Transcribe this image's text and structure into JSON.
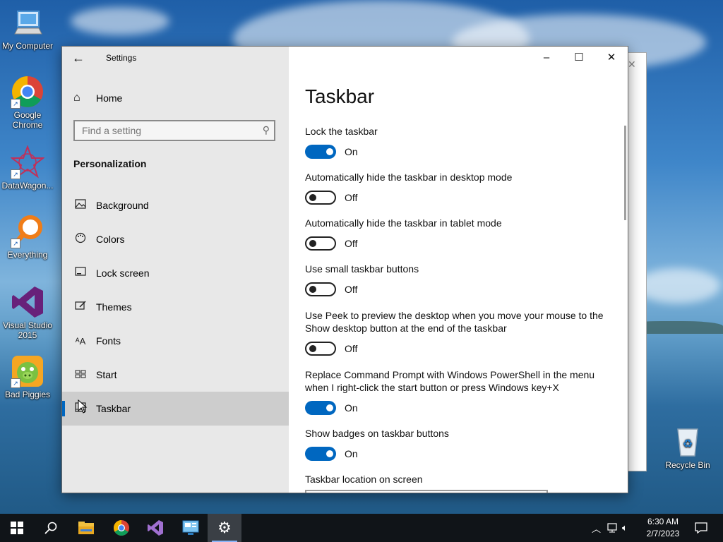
{
  "desktop": {
    "icons": [
      {
        "label": "My Computer",
        "icon": "computer-icon"
      },
      {
        "label": "Google Chrome",
        "icon": "chrome-icon"
      },
      {
        "label": "DataWagon...",
        "icon": "datawagon-icon"
      },
      {
        "label": "Everything",
        "icon": "everything-search-icon"
      },
      {
        "label": "Visual Studio 2015",
        "icon": "visual-studio-icon"
      },
      {
        "label": "Bad Piggies",
        "icon": "bad-piggies-icon"
      },
      {
        "label": "Recycle Bin",
        "icon": "recycle-bin-icon"
      }
    ]
  },
  "window": {
    "app_title": "Settings",
    "controls": {
      "minimize": "–",
      "maximize": "☐",
      "close": "✕"
    }
  },
  "sidebar": {
    "home_label": "Home",
    "search_placeholder": "Find a setting",
    "section_title": "Personalization",
    "items": [
      {
        "label": "Background",
        "icon": "picture-icon"
      },
      {
        "label": "Colors",
        "icon": "palette-icon"
      },
      {
        "label": "Lock screen",
        "icon": "lock-screen-icon"
      },
      {
        "label": "Themes",
        "icon": "themes-brush-icon"
      },
      {
        "label": "Fonts",
        "icon": "fonts-icon"
      },
      {
        "label": "Start",
        "icon": "start-grid-icon"
      },
      {
        "label": "Taskbar",
        "icon": "taskbar-icon",
        "selected": true
      }
    ]
  },
  "main": {
    "page_title": "Taskbar",
    "settings": [
      {
        "label": "Lock the taskbar",
        "state": "On",
        "on": true
      },
      {
        "label": "Automatically hide the taskbar in desktop mode",
        "state": "Off",
        "on": false
      },
      {
        "label": "Automatically hide the taskbar in tablet mode",
        "state": "Off",
        "on": false
      },
      {
        "label": "Use small taskbar buttons",
        "state": "Off",
        "on": false
      },
      {
        "label": "Use Peek to preview the desktop when you move your mouse to the Show desktop button at the end of the taskbar",
        "state": "Off",
        "on": false
      },
      {
        "label": "Replace Command Prompt with Windows PowerShell in the menu when I right-click the start button or press Windows key+X",
        "state": "On",
        "on": true
      },
      {
        "label": "Show badges on taskbar buttons",
        "state": "On",
        "on": true
      }
    ],
    "location_label": "Taskbar location on screen"
  },
  "taskbar": {
    "clock_time": "6:30 AM",
    "clock_date": "2/7/2023",
    "apps": [
      "start-icon",
      "search-icon",
      "file-explorer-icon",
      "chrome-icon",
      "visual-studio-icon",
      "control-panel-icon",
      "settings-gear-icon"
    ]
  },
  "colors": {
    "accent": "#0067c0",
    "sidebar_bg": "#e8e8e8",
    "taskbar_bg": "#101418"
  }
}
